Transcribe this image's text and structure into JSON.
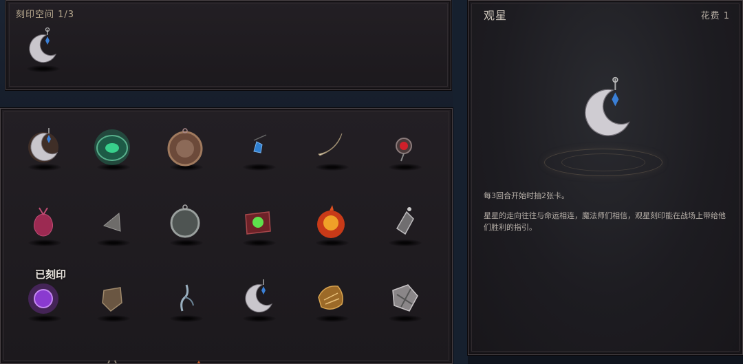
{
  "slot_panel": {
    "title": "刻印空间 1/3",
    "equipped_icon": "crescent-moon-pendant-icon"
  },
  "grid": {
    "equipped_label": "已刻印",
    "items": [
      {
        "icon": "crescent-moon-pendant-icon"
      },
      {
        "icon": "green-orb-amulet-icon"
      },
      {
        "icon": "bronze-medallion-icon"
      },
      {
        "icon": "blue-gem-pendant-icon"
      },
      {
        "icon": "crescent-fang-icon"
      },
      {
        "icon": "red-gem-amulet-icon"
      },
      {
        "icon": "crimson-pouch-icon"
      },
      {
        "icon": "stone-triangle-icon"
      },
      {
        "icon": "grey-orb-icon"
      },
      {
        "icon": "green-rune-tome-icon"
      },
      {
        "icon": "fire-orb-icon"
      },
      {
        "icon": "silver-shard-icon"
      },
      {
        "icon": "purple-arcane-orb-icon"
      },
      {
        "icon": "bronze-shield-icon"
      },
      {
        "icon": "wisp-figure-icon"
      },
      {
        "icon": "crescent-moon-pendant-icon"
      },
      {
        "icon": "golden-relic-icon"
      },
      {
        "icon": "spiked-shield-icon"
      }
    ]
  },
  "detail": {
    "title": "观星",
    "cost": "花费 1",
    "effect": "每3回合开始时抽2张卡。",
    "lore": "星星的走向往往与命运相连，魔法师们相信，观星刻印能在战场上带给他们胜利的指引。",
    "icon": "crescent-moon-pendant-icon"
  }
}
